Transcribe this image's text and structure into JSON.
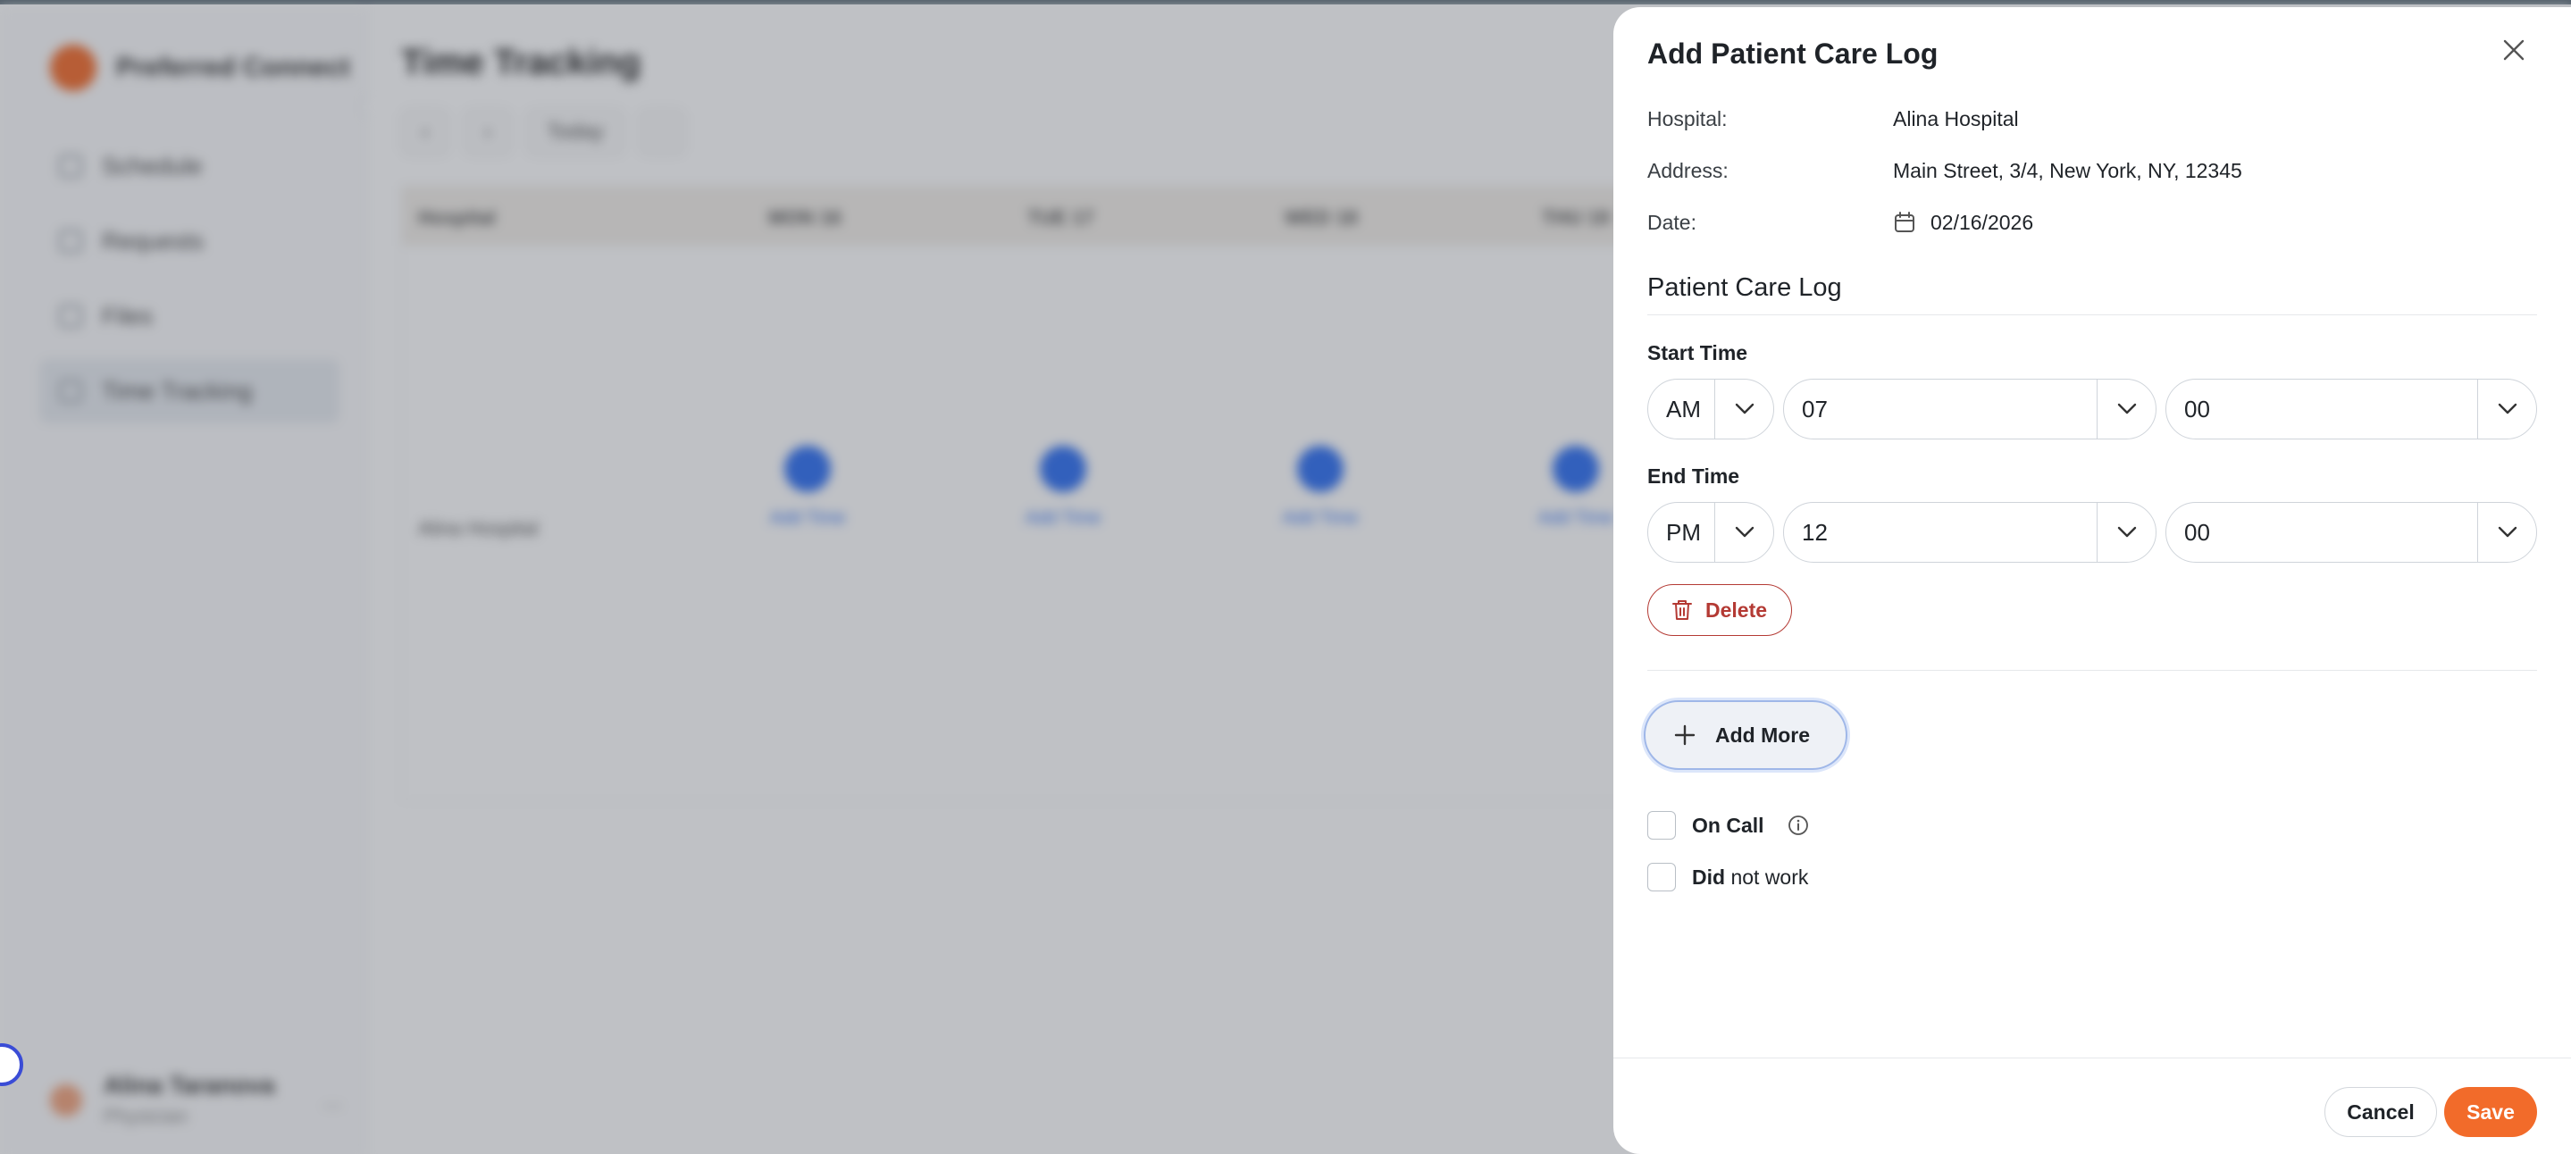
{
  "background": {
    "brand": "Preferred Connect",
    "nav": [
      "Schedule",
      "Requests",
      "Files",
      "Time Tracking"
    ],
    "page_title": "Time Tracking",
    "toolbar": {
      "prev": "‹",
      "next": "›",
      "today": "Today"
    },
    "grid_headers": [
      "Hospital",
      "MON 16",
      "TUE 17",
      "WED 18",
      "THU 19"
    ],
    "row_label": "Alina Hospital",
    "add_time_label": "Add Time",
    "user": {
      "name": "Alina Taranova",
      "role": "Physician",
      "menu": "..."
    }
  },
  "drawer": {
    "title": "Add Patient Care Log",
    "info": [
      {
        "label": "Hospital:",
        "value": "Alina Hospital"
      },
      {
        "label": "Address:",
        "value": "Main Street, 3/4, New York, NY, 12345"
      },
      {
        "label": "Date:",
        "value": "02/16/2026",
        "icon": "calendar-icon"
      }
    ],
    "section_title": "Patient Care Log",
    "start_time": {
      "label": "Start Time",
      "period": "AM",
      "hour": "07",
      "minute": "00"
    },
    "end_time": {
      "label": "End Time",
      "period": "PM",
      "hour": "12",
      "minute": "00"
    },
    "delete_label": "Delete",
    "add_more_label": "Add More",
    "on_call": {
      "bold": "On Call",
      "rest": ""
    },
    "did_not_work": {
      "bold": "Did",
      "rest": " not work"
    },
    "cancel_label": "Cancel",
    "save_label": "Save"
  },
  "colors": {
    "accent": "#f26b2a",
    "danger": "#b43a34",
    "link": "#2e6ff2"
  }
}
